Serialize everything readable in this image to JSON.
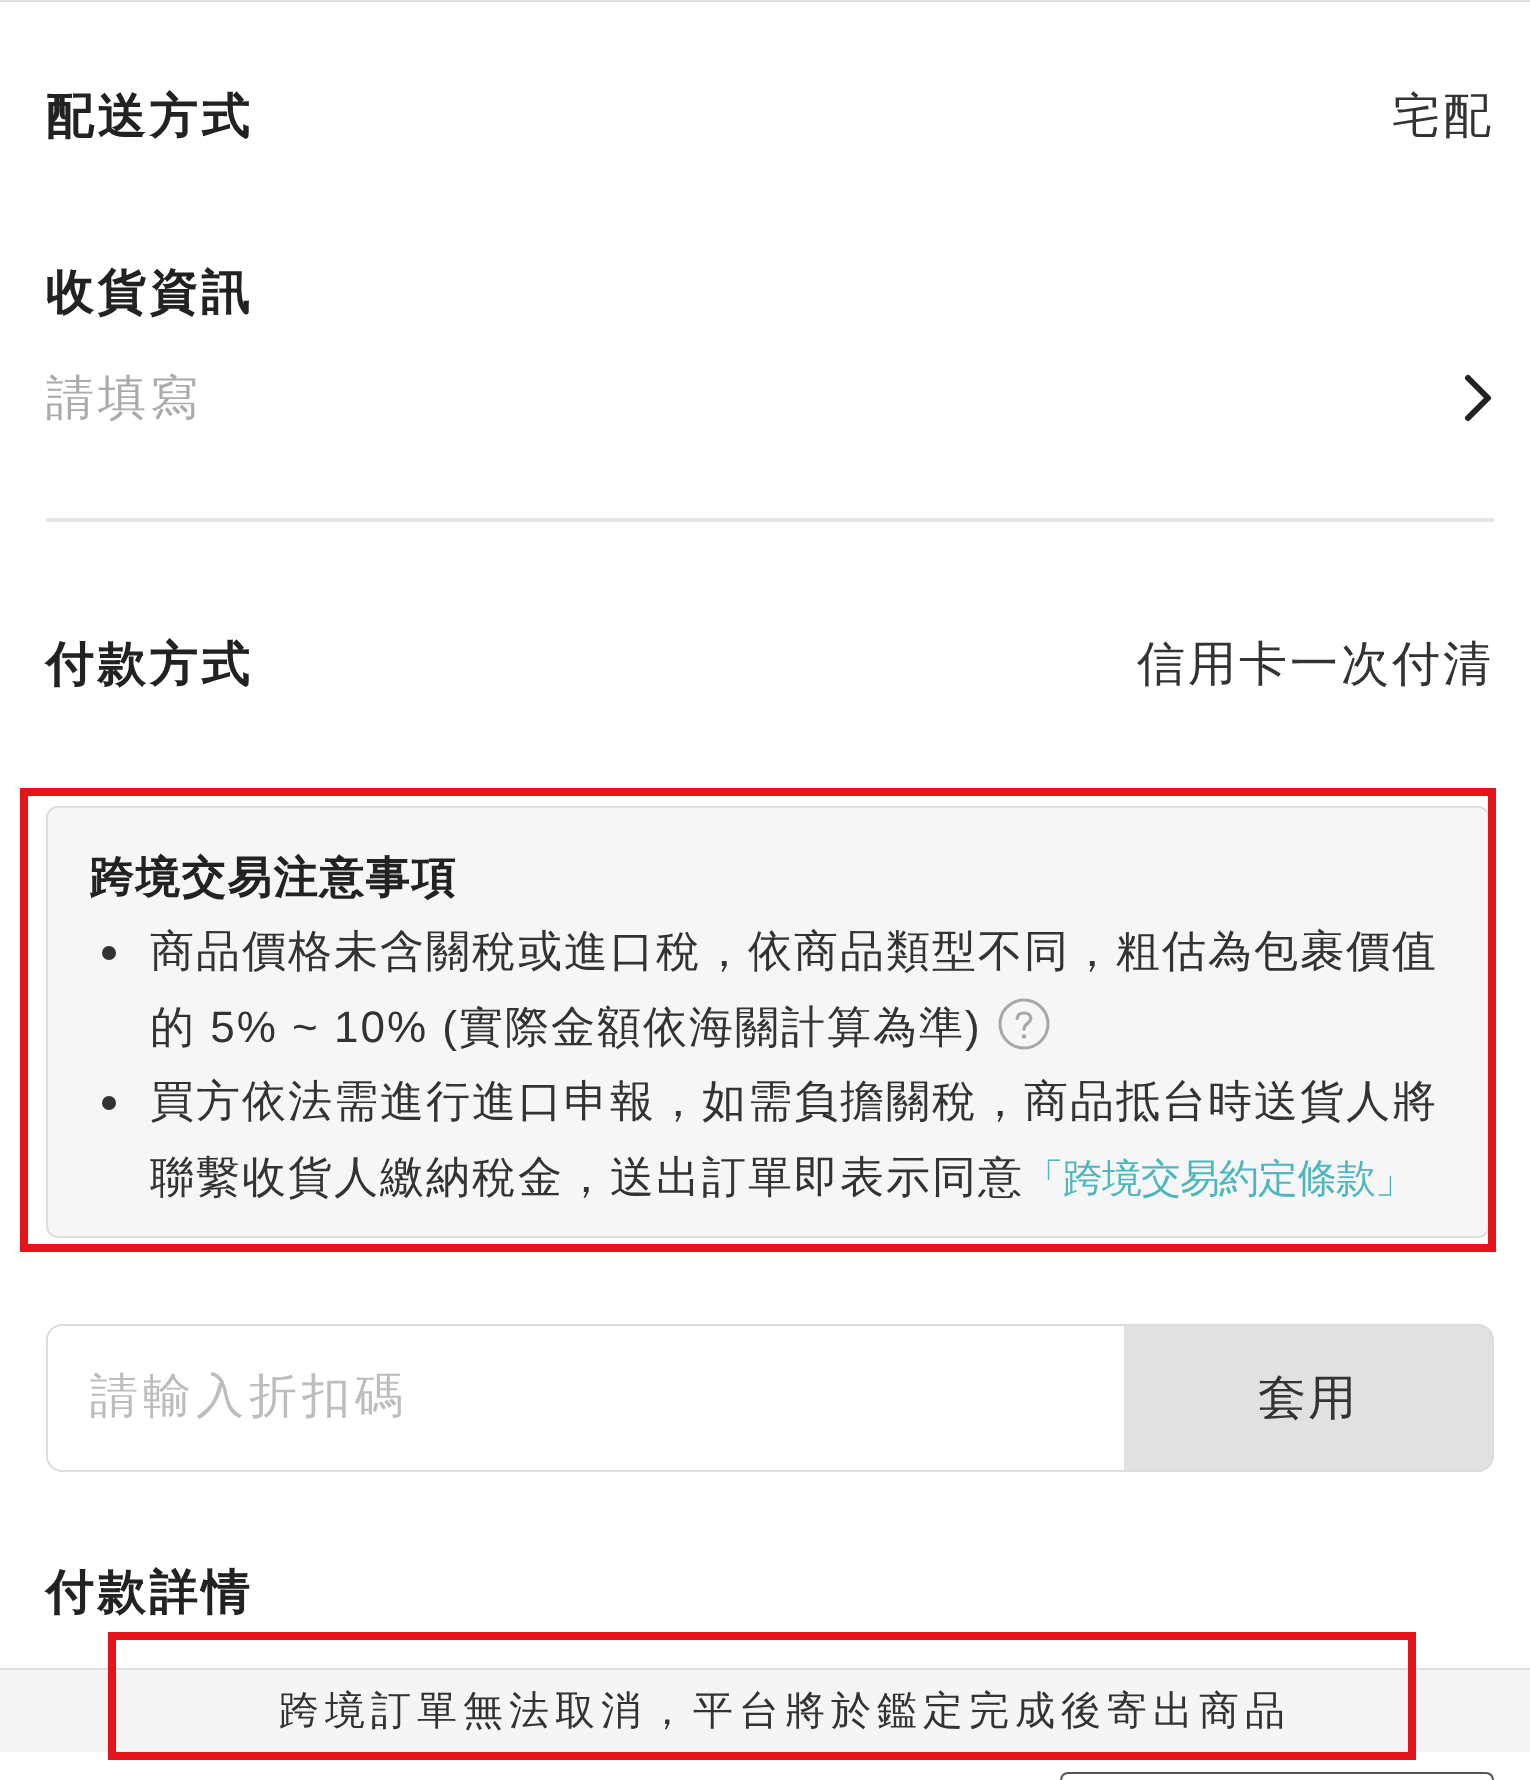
{
  "delivery": {
    "label": "配送方式",
    "value": "宅配"
  },
  "shipping_info": {
    "label": "收貨資訊",
    "hint": "請填寫"
  },
  "payment_method": {
    "label": "付款方式",
    "value": "信用卡一次付清"
  },
  "notice": {
    "title": "跨境交易注意事項",
    "highlighted": true,
    "items": [
      {
        "text": "商品價格未含關稅或進口稅，依商品類型不同，粗估為包裹價值的 5% ~ 10% (實際金額依海關計算為準)",
        "help": true
      },
      {
        "text": "買方依法需進行進口申報，如需負擔關稅，商品抵台時送貨人將聯繫收貨人繳納稅金，送出訂單即表示同意",
        "link": "「跨境交易約定條款」"
      }
    ]
  },
  "coupon": {
    "placeholder": "請輸入折扣碼",
    "button": "套用"
  },
  "payment_details": {
    "title": "付款詳情"
  },
  "banner": {
    "text": "跨境訂單無法取消，平台將於鑑定完成後寄出商品",
    "highlighted": true
  }
}
